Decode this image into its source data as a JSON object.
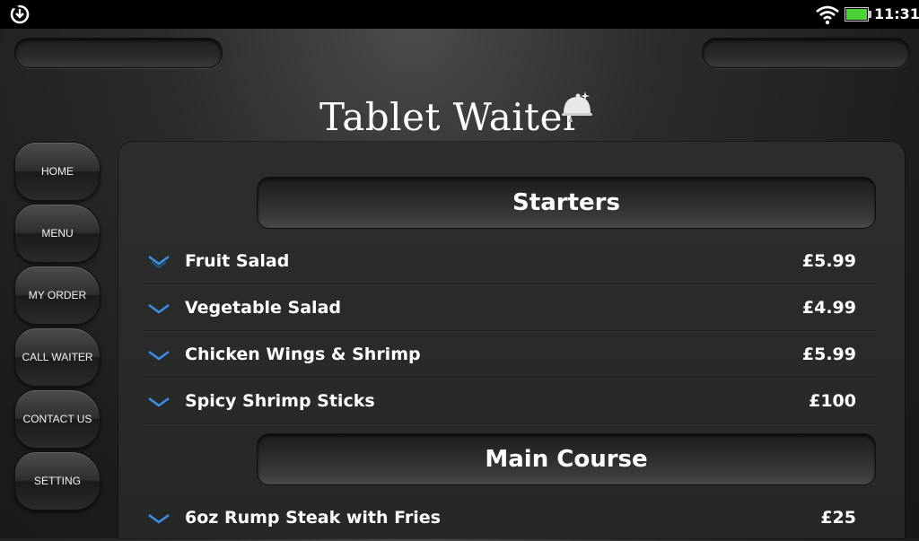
{
  "status_bar": {
    "time": "11:31",
    "icons": [
      "sync-download-icon",
      "wifi-icon",
      "battery-icon"
    ],
    "battery_color": "#4cd137"
  },
  "app": {
    "title": "Tablet Waiter",
    "logo_icon": "cloche-icon"
  },
  "nav": {
    "items": [
      {
        "label": "HOME"
      },
      {
        "label": "MENU"
      },
      {
        "label": "MY ORDER"
      },
      {
        "label": "CALL WAITER"
      },
      {
        "label": "CONTACT US"
      },
      {
        "label": "SETTING"
      }
    ]
  },
  "menu": {
    "accent_color": "#3a8ee6",
    "sections": [
      {
        "title": "Starters",
        "items": [
          {
            "name": "Fruit Salad",
            "price": "£5.99"
          },
          {
            "name": "Vegetable Salad",
            "price": "£4.99"
          },
          {
            "name": "Chicken Wings & Shrimp",
            "price": "£5.99"
          },
          {
            "name": "Spicy Shrimp Sticks",
            "price": "£100"
          }
        ]
      },
      {
        "title": "Main Course",
        "items": [
          {
            "name": "6oz Rump Steak with Fries",
            "price": "£25"
          }
        ]
      }
    ]
  }
}
